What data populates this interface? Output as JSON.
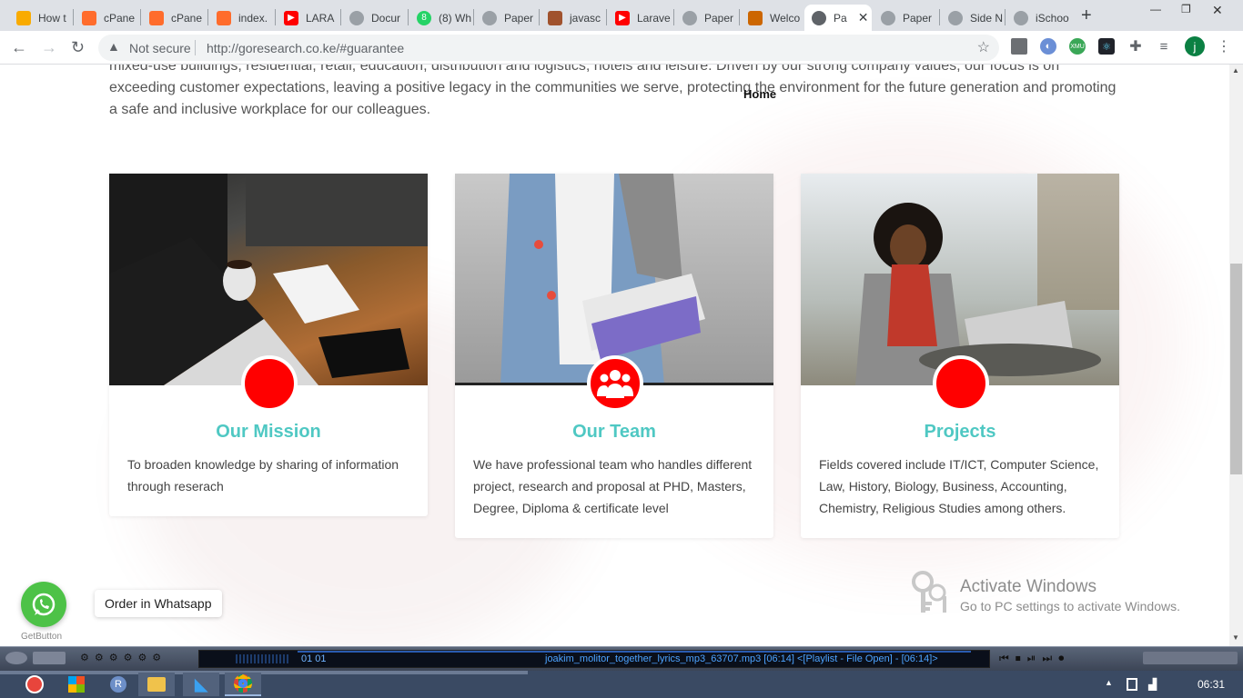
{
  "browser": {
    "tabs": [
      {
        "label": "How t",
        "color": "#f9ab00",
        "glyph": ""
      },
      {
        "label": "cPane",
        "color": "#ff6c2c",
        "glyph": ""
      },
      {
        "label": "cPane",
        "color": "#ff6c2c",
        "glyph": ""
      },
      {
        "label": "index.",
        "color": "#ff6c2c",
        "glyph": ""
      },
      {
        "label": "LARA",
        "color": "#ff0000",
        "glyph": "▶"
      },
      {
        "label": "Docur",
        "color": "#5f6368",
        "glyph": ""
      },
      {
        "label": "(8) Wh",
        "color": "#25d366",
        "glyph": "8"
      },
      {
        "label": "Paper",
        "color": "#5f6368",
        "glyph": ""
      },
      {
        "label": "javasc",
        "color": "#a0522d",
        "glyph": ""
      },
      {
        "label": "Larave",
        "color": "#ff0000",
        "glyph": "▶"
      },
      {
        "label": "Paper",
        "color": "#5f6368",
        "glyph": ""
      },
      {
        "label": "Welco",
        "color": "#cc6600",
        "glyph": ""
      },
      {
        "label": "Pa",
        "color": "#5f6368",
        "glyph": ""
      },
      {
        "label": "Paper",
        "color": "#5f6368",
        "glyph": ""
      },
      {
        "label": "Side N",
        "color": "#5f6368",
        "glyph": ""
      },
      {
        "label": "iSchoo",
        "color": "#5f6368",
        "glyph": ""
      }
    ],
    "security": "Not secure",
    "url": "http://goresearch.co.ke/#guarantee",
    "profile_initial": "j"
  },
  "page": {
    "intro": "mixed-use buildings, residential, retail, education, distribution and logistics, hotels and leisure. Driven by our strong company values, our focus is on exceeding customer expectations, leaving a positive legacy in the communities we serve, protecting the environment for the future generation and promoting a safe and inclusive workplace for our colleagues.",
    "home_link": "Home",
    "cards": [
      {
        "title": "Our Mission",
        "text": "To broaden knowledge by sharing of information through reserach"
      },
      {
        "title": "Our Team",
        "text": "We have professional team who handles different project, research and proposal at PHD, Masters, Degree, Diploma & certificate level"
      },
      {
        "title": "Projects",
        "text": "Fields covered include IT/ICT, Computer Science, Law, History, Biology, Business, Accounting, Chemistry, Religious Studies among others."
      }
    ],
    "whatsapp_label": "Order in Whatsapp",
    "getbutton": "GetButton",
    "accent_color": "#4fc8c3",
    "circle_color": "#ff0000"
  },
  "overlay": {
    "activate_title": "Activate Windows",
    "activate_sub": "Go to PC settings to activate Windows."
  },
  "player": {
    "counter": "01     01",
    "track": "joakim_molitor_together_lyrics_mp3_63707.mp3   [06:14]     <[Playlist - File Open] - [06:14]>"
  },
  "taskbar": {
    "clock": "06:31"
  }
}
